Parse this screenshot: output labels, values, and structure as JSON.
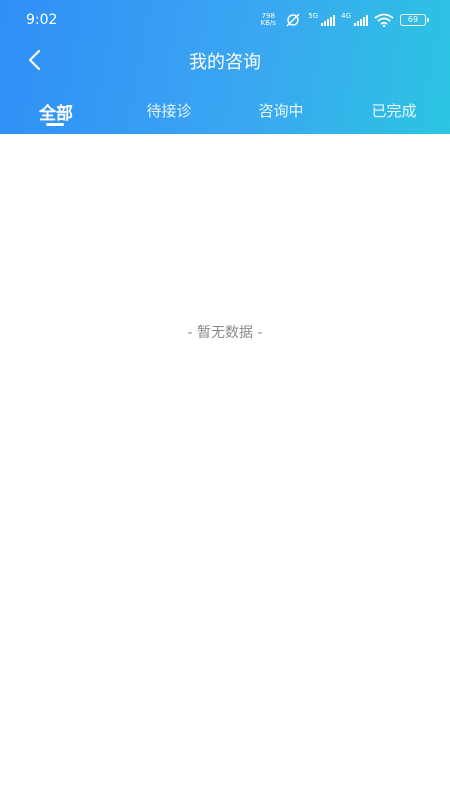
{
  "status_bar": {
    "time": "9:02",
    "net_speed_value": "798",
    "net_speed_unit": "KB/s",
    "sim1_label": "5G",
    "sim2_label": "4G",
    "battery": "69",
    "icons": [
      "muted-alarm-icon",
      "signal-icon",
      "signal-icon",
      "wifi-icon",
      "battery-icon"
    ]
  },
  "header": {
    "back_icon": "chevron-left-icon",
    "title": "我的咨询"
  },
  "tabs": [
    {
      "label": "全部",
      "active": true
    },
    {
      "label": "待接诊",
      "active": false
    },
    {
      "label": "咨询中",
      "active": false
    },
    {
      "label": "已完成",
      "active": false
    }
  ],
  "content": {
    "empty_text": "- 暂无数据 -"
  },
  "colors": {
    "gradient_start": "#2f8ff7",
    "gradient_end": "#2cc5e2",
    "empty_text": "#8a8a8a"
  }
}
